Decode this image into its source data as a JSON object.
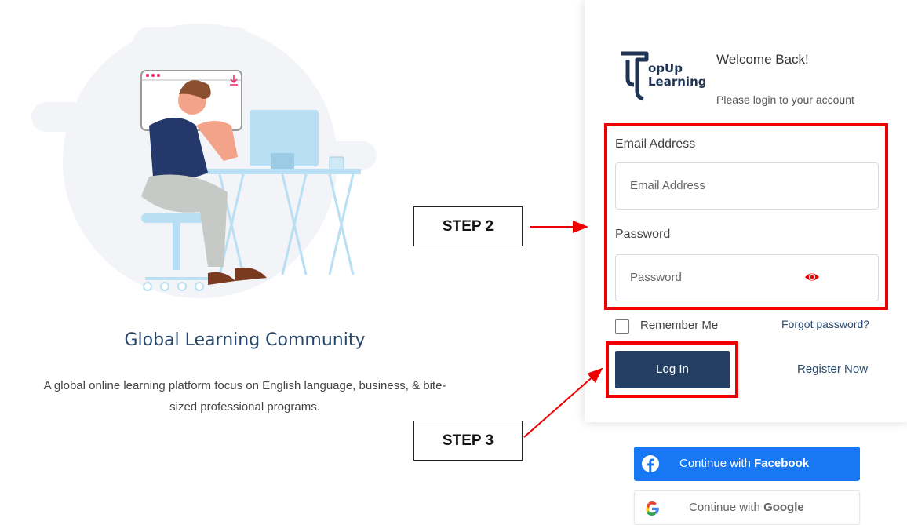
{
  "left": {
    "title": "Global Learning Community",
    "description_line1": "A global online learning platform focus on English language, business, & bite-",
    "description_line2": "sized professional programs."
  },
  "login": {
    "logo_text_1": "opUp",
    "logo_text_2": "Learning",
    "welcome": "Welcome Back!",
    "subtitle": "Please login to your account",
    "email_label": "Email Address",
    "email_placeholder": "Email Address",
    "password_label": "Password",
    "password_placeholder": "Password",
    "remember_label": "Remember Me",
    "remember_checked": false,
    "forgot_link": "Forgot password?",
    "login_button": "Log In",
    "register_link": "Register Now"
  },
  "social": {
    "facebook_prefix": "Continue with ",
    "facebook_brand": "Facebook",
    "google_prefix": "Continue with ",
    "google_brand": "Google"
  },
  "annotations": {
    "step2": "STEP 2",
    "step3": "STEP 3",
    "highlight_color": "#ee0000"
  },
  "colors": {
    "brand_navy": "#243f62",
    "facebook_blue": "#1877f2",
    "title_color": "#26476b"
  },
  "icons": {
    "password_toggle": "eye-icon",
    "facebook": "facebook-icon",
    "google": "google-icon"
  }
}
